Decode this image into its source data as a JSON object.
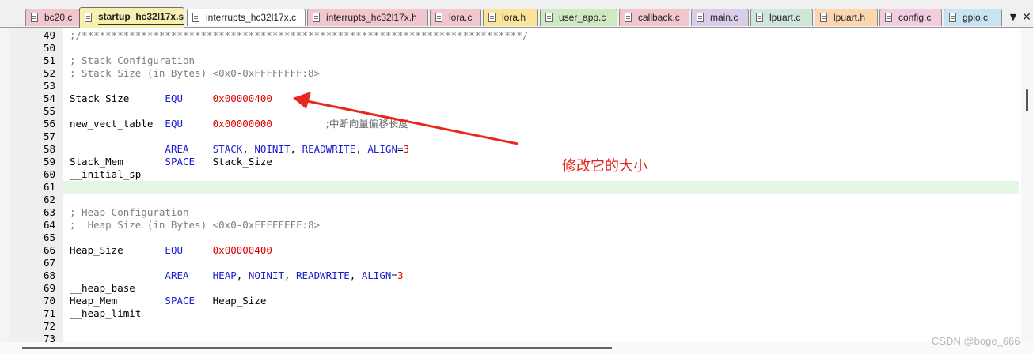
{
  "tabs": [
    {
      "label": "bc20.c",
      "color": "#f2c6cf",
      "active": false
    },
    {
      "label": "startup_hc32l17x.s",
      "color": "#f8f0b0",
      "active": true
    },
    {
      "label": "interrupts_hc32l17x.c",
      "color": "#ffffff",
      "active": false
    },
    {
      "label": "interrupts_hc32l17x.h",
      "color": "#f2c6cf",
      "active": false
    },
    {
      "label": "lora.c",
      "color": "#f2c6cf",
      "active": false
    },
    {
      "label": "lora.h",
      "color": "#fbe49a",
      "active": false
    },
    {
      "label": "user_app.c",
      "color": "#cfe9c2",
      "active": false
    },
    {
      "label": "callback.c",
      "color": "#f2c6cf",
      "active": false
    },
    {
      "label": "main.c",
      "color": "#d9cdea",
      "active": false
    },
    {
      "label": "lpuart.c",
      "color": "#cfe6da",
      "active": false
    },
    {
      "label": "lpuart.h",
      "color": "#fbd6b0",
      "active": false
    },
    {
      "label": "config.c",
      "color": "#f2cde0",
      "active": false
    },
    {
      "label": "gpio.c",
      "color": "#c8e4f0",
      "active": false
    }
  ],
  "tab_menu": "▼",
  "tab_close": "✕",
  "editor": {
    "current_line": "61",
    "lines": [
      {
        "num": "49",
        "segs": [
          {
            "t": ";/**************************************************************************/",
            "c": "c"
          }
        ]
      },
      {
        "num": "50",
        "segs": []
      },
      {
        "num": "51",
        "segs": [
          {
            "t": "; Stack Configuration",
            "c": "c"
          }
        ]
      },
      {
        "num": "52",
        "segs": [
          {
            "t": "; Stack Size (in Bytes) <0x0-0xFFFFFFFF:8>",
            "c": "c"
          }
        ]
      },
      {
        "num": "53",
        "segs": []
      },
      {
        "num": "54",
        "segs": [
          {
            "t": "Stack_Size      ",
            "c": ""
          },
          {
            "t": "EQU",
            "c": "k"
          },
          {
            "t": "     ",
            "c": ""
          },
          {
            "t": "0x00000400",
            "c": "n"
          }
        ]
      },
      {
        "num": "55",
        "segs": []
      },
      {
        "num": "56",
        "segs": [
          {
            "t": "new_vect_table  ",
            "c": ""
          },
          {
            "t": "EQU",
            "c": "k"
          },
          {
            "t": "     ",
            "c": ""
          },
          {
            "t": "0x00000000",
            "c": "n"
          },
          {
            "t": "         ",
            "c": ""
          },
          {
            "t": ";中断向量偏移长度",
            "c": "cn"
          }
        ]
      },
      {
        "num": "57",
        "segs": []
      },
      {
        "num": "58",
        "segs": [
          {
            "t": "                ",
            "c": ""
          },
          {
            "t": "AREA",
            "c": "k"
          },
          {
            "t": "    ",
            "c": ""
          },
          {
            "t": "STACK",
            "c": "k"
          },
          {
            "t": ", ",
            "c": ""
          },
          {
            "t": "NOINIT",
            "c": "k"
          },
          {
            "t": ", ",
            "c": ""
          },
          {
            "t": "READWRITE",
            "c": "k"
          },
          {
            "t": ", ",
            "c": ""
          },
          {
            "t": "ALIGN",
            "c": "k"
          },
          {
            "t": "=",
            "c": ""
          },
          {
            "t": "3",
            "c": "n"
          }
        ]
      },
      {
        "num": "59",
        "segs": [
          {
            "t": "Stack_Mem       ",
            "c": ""
          },
          {
            "t": "SPACE",
            "c": "k"
          },
          {
            "t": "   Stack_Size",
            "c": ""
          }
        ]
      },
      {
        "num": "60",
        "segs": [
          {
            "t": "__initial_sp",
            "c": ""
          }
        ]
      },
      {
        "num": "61",
        "segs": []
      },
      {
        "num": "62",
        "segs": []
      },
      {
        "num": "63",
        "segs": [
          {
            "t": "; Heap Configuration",
            "c": "c"
          }
        ]
      },
      {
        "num": "64",
        "segs": [
          {
            "t": ";  Heap Size (in Bytes) <0x0-0xFFFFFFFF:8>",
            "c": "c"
          }
        ]
      },
      {
        "num": "65",
        "segs": []
      },
      {
        "num": "66",
        "segs": [
          {
            "t": "Heap_Size       ",
            "c": ""
          },
          {
            "t": "EQU",
            "c": "k"
          },
          {
            "t": "     ",
            "c": ""
          },
          {
            "t": "0x00000400",
            "c": "n"
          }
        ]
      },
      {
        "num": "67",
        "segs": []
      },
      {
        "num": "68",
        "segs": [
          {
            "t": "                ",
            "c": ""
          },
          {
            "t": "AREA",
            "c": "k"
          },
          {
            "t": "    ",
            "c": ""
          },
          {
            "t": "HEAP",
            "c": "k"
          },
          {
            "t": ", ",
            "c": ""
          },
          {
            "t": "NOINIT",
            "c": "k"
          },
          {
            "t": ", ",
            "c": ""
          },
          {
            "t": "READWRITE",
            "c": "k"
          },
          {
            "t": ", ",
            "c": ""
          },
          {
            "t": "ALIGN",
            "c": "k"
          },
          {
            "t": "=",
            "c": ""
          },
          {
            "t": "3",
            "c": "n"
          }
        ]
      },
      {
        "num": "69",
        "segs": [
          {
            "t": "__heap_base",
            "c": ""
          }
        ]
      },
      {
        "num": "70",
        "segs": [
          {
            "t": "Heap_Mem        ",
            "c": ""
          },
          {
            "t": "SPACE",
            "c": "k"
          },
          {
            "t": "   Heap_Size",
            "c": ""
          }
        ]
      },
      {
        "num": "71",
        "segs": [
          {
            "t": "__heap_limit",
            "c": ""
          }
        ]
      },
      {
        "num": "72",
        "segs": []
      },
      {
        "num": "73",
        "segs": []
      }
    ]
  },
  "annotation": {
    "text": "修改它的大小",
    "color": "#e3221b"
  },
  "watermark": "CSDN @boge_666"
}
